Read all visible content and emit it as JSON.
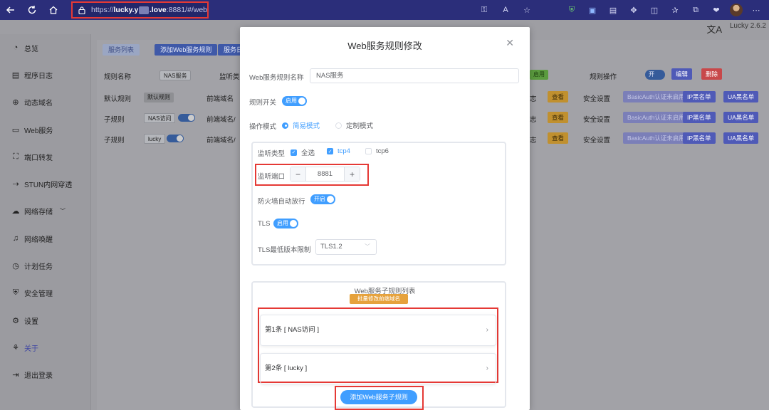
{
  "browser": {
    "url_prefix": "https://",
    "url_host_a": "lucky.y",
    "url_host_b": ".love",
    "url_port_path": ":8881/#/web",
    "icons": [
      "back-icon",
      "refresh-icon",
      "home-icon",
      "lock-icon",
      "key-icon",
      "read-aloud-icon",
      "star-icon",
      "shield-icon",
      "translate-ext-icon",
      "media-icon",
      "extensions-icon",
      "split-icon",
      "favorites-icon",
      "collections-icon",
      "performance-icon",
      "profile-avatar"
    ]
  },
  "app": {
    "version": "Lucky 2.6.2",
    "lang_icon": "translate-icon",
    "sidebar": [
      {
        "label": "总览",
        "icon": "dashboard-icon"
      },
      {
        "label": "程序日志",
        "icon": "log-icon"
      },
      {
        "label": "动态域名",
        "icon": "ddns-icon"
      },
      {
        "label": "Web服务",
        "icon": "web-icon"
      },
      {
        "label": "端口转发",
        "icon": "port-forward-icon"
      },
      {
        "label": "STUN内网穿透",
        "icon": "stun-icon"
      },
      {
        "label": "网络存储",
        "icon": "storage-icon"
      },
      {
        "label": "网络唤醒",
        "icon": "wol-icon"
      },
      {
        "label": "计划任务",
        "icon": "schedule-icon"
      },
      {
        "label": "安全管理",
        "icon": "security-icon"
      },
      {
        "label": "设置",
        "icon": "settings-icon"
      },
      {
        "label": "关于",
        "icon": "about-icon"
      },
      {
        "label": "退出登录",
        "icon": "logout-icon"
      }
    ],
    "tabs": [
      "服务列表",
      "添加Web服务规则",
      "服务日"
    ],
    "table": {
      "col_rule_name": "规则名称",
      "col_listen": "监听类",
      "col_ops": "规则操作",
      "rule_name_value": "NAS服务",
      "status_tag": "启用",
      "toggle_label": "开",
      "edit": "编辑",
      "delete": "删除",
      "rows": [
        {
          "type": "默认规则",
          "tag": "默认规则",
          "domain": "前端域名"
        },
        {
          "type": "子规则",
          "tag": "NAS访问",
          "domain": "前端域名/"
        },
        {
          "type": "子规则",
          "tag": "lucky",
          "domain": "前端域名/"
        }
      ],
      "log_suffix": "志",
      "view": "查看",
      "security": "安全设置",
      "basic_auth": "BasicAuth认证未启用",
      "ip_list": "IP黑名单",
      "ua_list": "UA黑名单"
    }
  },
  "modal": {
    "title": "Web服务规则修改",
    "name_label": "Web服务规则名称",
    "name_value": "NAS服务",
    "switch_label": "规则开关",
    "switch_text": "启用",
    "mode_label": "操作模式",
    "mode_simple": "简易模式",
    "mode_custom": "定制模式",
    "listen_type_label": "监听类型",
    "opt_all": "全选",
    "opt_tcp4": "tcp4",
    "opt_tcp6": "tcp6",
    "port_label": "监听端口",
    "port_value": "8881",
    "firewall_label": "防火墙自动放行",
    "firewall_text": "开启",
    "tls_label": "TLS",
    "tls_text": "启用",
    "tls_min_label": "TLS最低版本限制",
    "tls_min_value": "TLS1.2",
    "sub_list_title": "Web服务子规则列表",
    "batch_edit": "批量修改前端域名",
    "sub_rules": [
      "第1条 [ NAS访问 ]",
      "第2条 [ lucky ]"
    ],
    "add_sub_rule": "添加Web服务子规则"
  },
  "colors": {
    "accent": "#409eff",
    "highlight": "#e53935",
    "chrome": "#2b2e7a",
    "warning": "#e6a23c"
  }
}
